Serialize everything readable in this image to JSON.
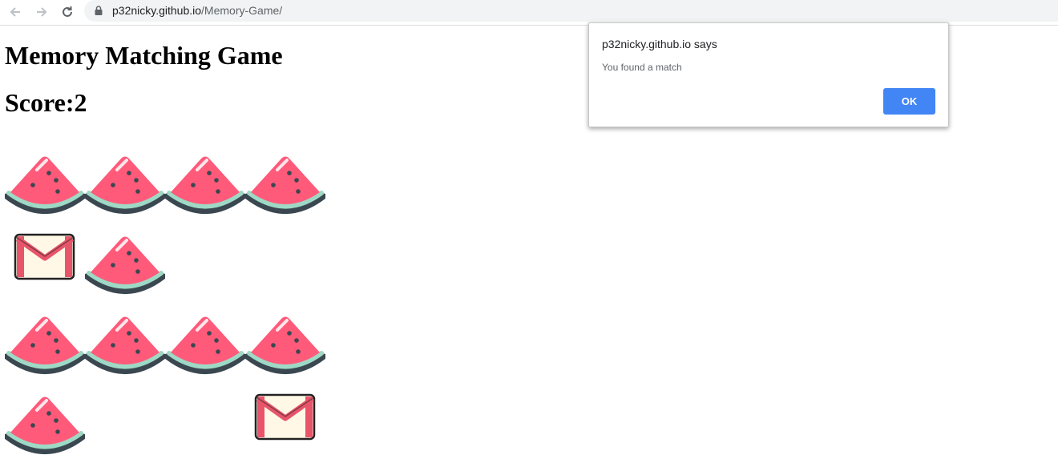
{
  "browser": {
    "url_host": "p32nicky.github.io",
    "url_path": "/Memory-Game/"
  },
  "page": {
    "title": "Memory Matching Game",
    "score_label": "Score:2"
  },
  "board": {
    "cards": [
      {
        "state": "watermelon"
      },
      {
        "state": "watermelon"
      },
      {
        "state": "watermelon"
      },
      {
        "state": "watermelon"
      },
      {
        "state": "mail"
      },
      {
        "state": "watermelon"
      },
      {
        "state": "empty"
      },
      {
        "state": "empty"
      },
      {
        "state": "watermelon"
      },
      {
        "state": "watermelon"
      },
      {
        "state": "watermelon"
      },
      {
        "state": "watermelon"
      },
      {
        "state": "watermelon"
      },
      {
        "state": "empty"
      },
      {
        "state": "empty"
      },
      {
        "state": "mail"
      }
    ]
  },
  "dialog": {
    "title": "p32nicky.github.io says",
    "message": "You found a match",
    "ok_label": "OK"
  },
  "colors": {
    "watermelon_flesh": "#ff5a79",
    "rind": "#9ed9c5",
    "rind_outline": "#3a4750",
    "mail_paper": "#fff8e6",
    "mail_red": "#e8546a",
    "ok_button": "#4285f4"
  }
}
